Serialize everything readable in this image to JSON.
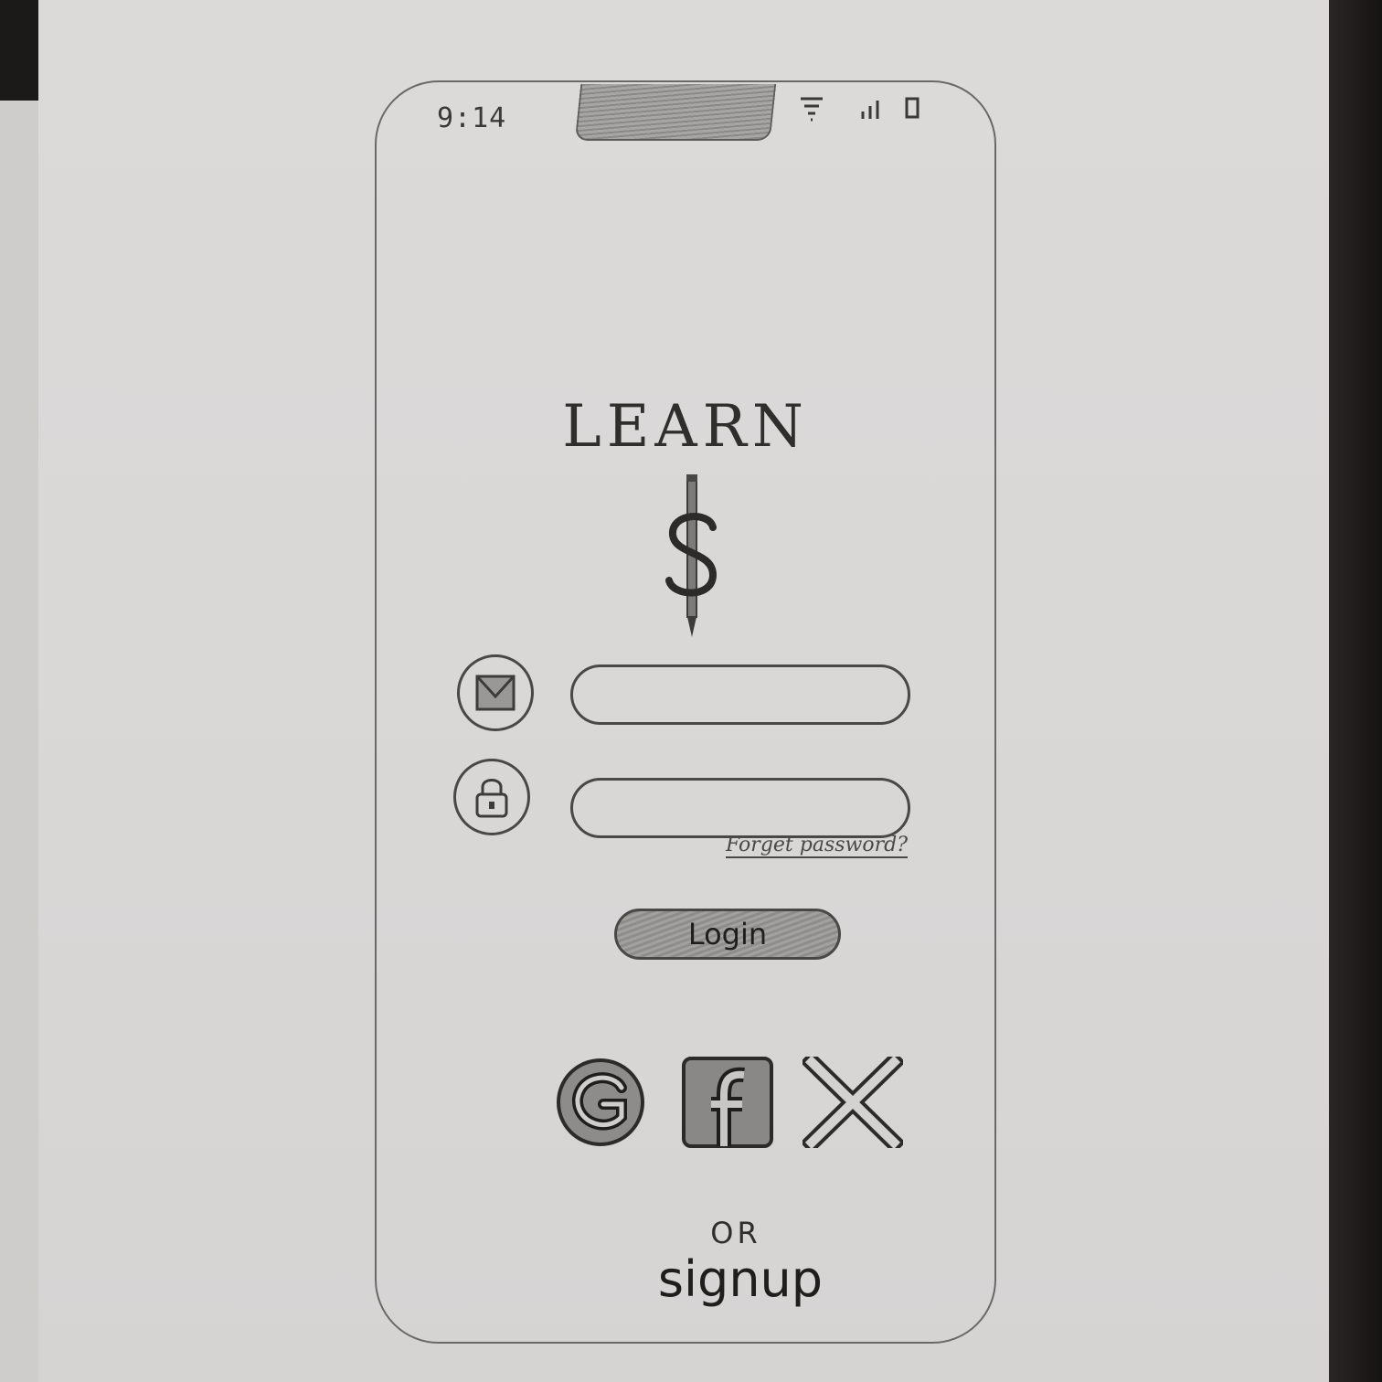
{
  "status_bar": {
    "time": "9:14",
    "icons": [
      "wifi-icon",
      "signal-icon",
      "battery-icon"
    ]
  },
  "brand": {
    "title": "LEARN",
    "logo_icon": "pencil-dollar-logo"
  },
  "form": {
    "email": {
      "icon": "mail-icon",
      "value": "",
      "placeholder": ""
    },
    "password": {
      "icon": "lock-icon",
      "value": "",
      "placeholder": ""
    },
    "forget_link": "Forget password?",
    "login_label": "Login"
  },
  "social": {
    "providers": [
      {
        "name": "google",
        "icon": "google-icon"
      },
      {
        "name": "facebook",
        "icon": "facebook-icon"
      },
      {
        "name": "x",
        "icon": "x-icon"
      }
    ]
  },
  "footer": {
    "or_label": "OR",
    "signup_label": "signup"
  }
}
